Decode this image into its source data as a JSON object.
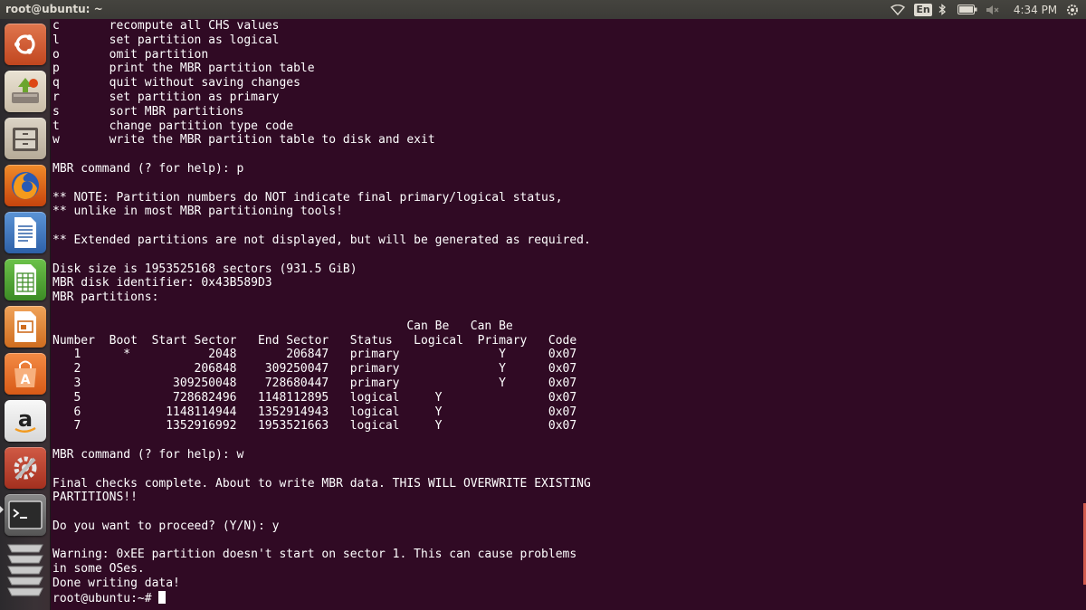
{
  "top_panel": {
    "window_title": "root@ubuntu: ~",
    "keyboard_layout": "En",
    "clock": "4:34 PM",
    "icons": [
      "wifi-icon",
      "keyboard-layout-icon",
      "bluetooth-icon",
      "battery-icon",
      "volume-muted-icon"
    ]
  },
  "launcher": {
    "items": [
      {
        "name": "dash-home",
        "icon": "ubuntu-logo-icon"
      },
      {
        "name": "installer",
        "icon": "install-ubuntu-icon"
      },
      {
        "name": "files",
        "icon": "file-cabinet-icon"
      },
      {
        "name": "firefox",
        "icon": "firefox-icon"
      },
      {
        "name": "libreoffice-writer",
        "icon": "writer-document-icon"
      },
      {
        "name": "libreoffice-calc",
        "icon": "calc-spreadsheet-icon"
      },
      {
        "name": "libreoffice-impress",
        "icon": "impress-presentation-icon"
      },
      {
        "name": "software-center",
        "icon": "shopping-bag-icon"
      },
      {
        "name": "amazon",
        "icon": "amazon-icon"
      },
      {
        "name": "system-settings",
        "icon": "settings-gear-wrench-icon"
      },
      {
        "name": "terminal",
        "icon": "terminal-icon"
      },
      {
        "name": "workspace-switcher",
        "icon": "workspaces-icon"
      }
    ]
  },
  "terminal": {
    "lines": [
      "c       recompute all CHS values",
      "l       set partition as logical",
      "o       omit partition",
      "p       print the MBR partition table",
      "q       quit without saving changes",
      "r       set partition as primary",
      "s       sort MBR partitions",
      "t       change partition type code",
      "w       write the MBR partition table to disk and exit",
      "",
      "MBR command (? for help): p",
      "",
      "** NOTE: Partition numbers do NOT indicate final primary/logical status,",
      "** unlike in most MBR partitioning tools!",
      "",
      "** Extended partitions are not displayed, but will be generated as required.",
      "",
      "Disk size is 1953525168 sectors (931.5 GiB)",
      "MBR disk identifier: 0x43B589D3",
      "MBR partitions:",
      "",
      "                                                  Can Be   Can Be",
      "Number  Boot  Start Sector   End Sector   Status   Logical  Primary   Code",
      "   1      *           2048       206847   primary              Y      0x07",
      "   2                206848    309250047   primary              Y      0x07",
      "   3             309250048    728680447   primary              Y      0x07",
      "   5             728682496   1148112895   logical     Y               0x07",
      "   6            1148114944   1352914943   logical     Y               0x07",
      "   7            1352916992   1953521663   logical     Y               0x07",
      "",
      "MBR command (? for help): w",
      "",
      "Final checks complete. About to write MBR data. THIS WILL OVERWRITE EXISTING",
      "PARTITIONS!!",
      "",
      "Do you want to proceed? (Y/N): y",
      "",
      "Warning: 0xEE partition doesn't start on sector 1. This can cause problems",
      "in some OSes.",
      "Done writing data!"
    ],
    "prompt": "root@ubuntu:~# "
  },
  "colors": {
    "terminal_bg": "#300a24",
    "terminal_fg": "#ffffff",
    "panel_bg": "#3c3b37",
    "launcher_bg": "#2c2a2d"
  }
}
